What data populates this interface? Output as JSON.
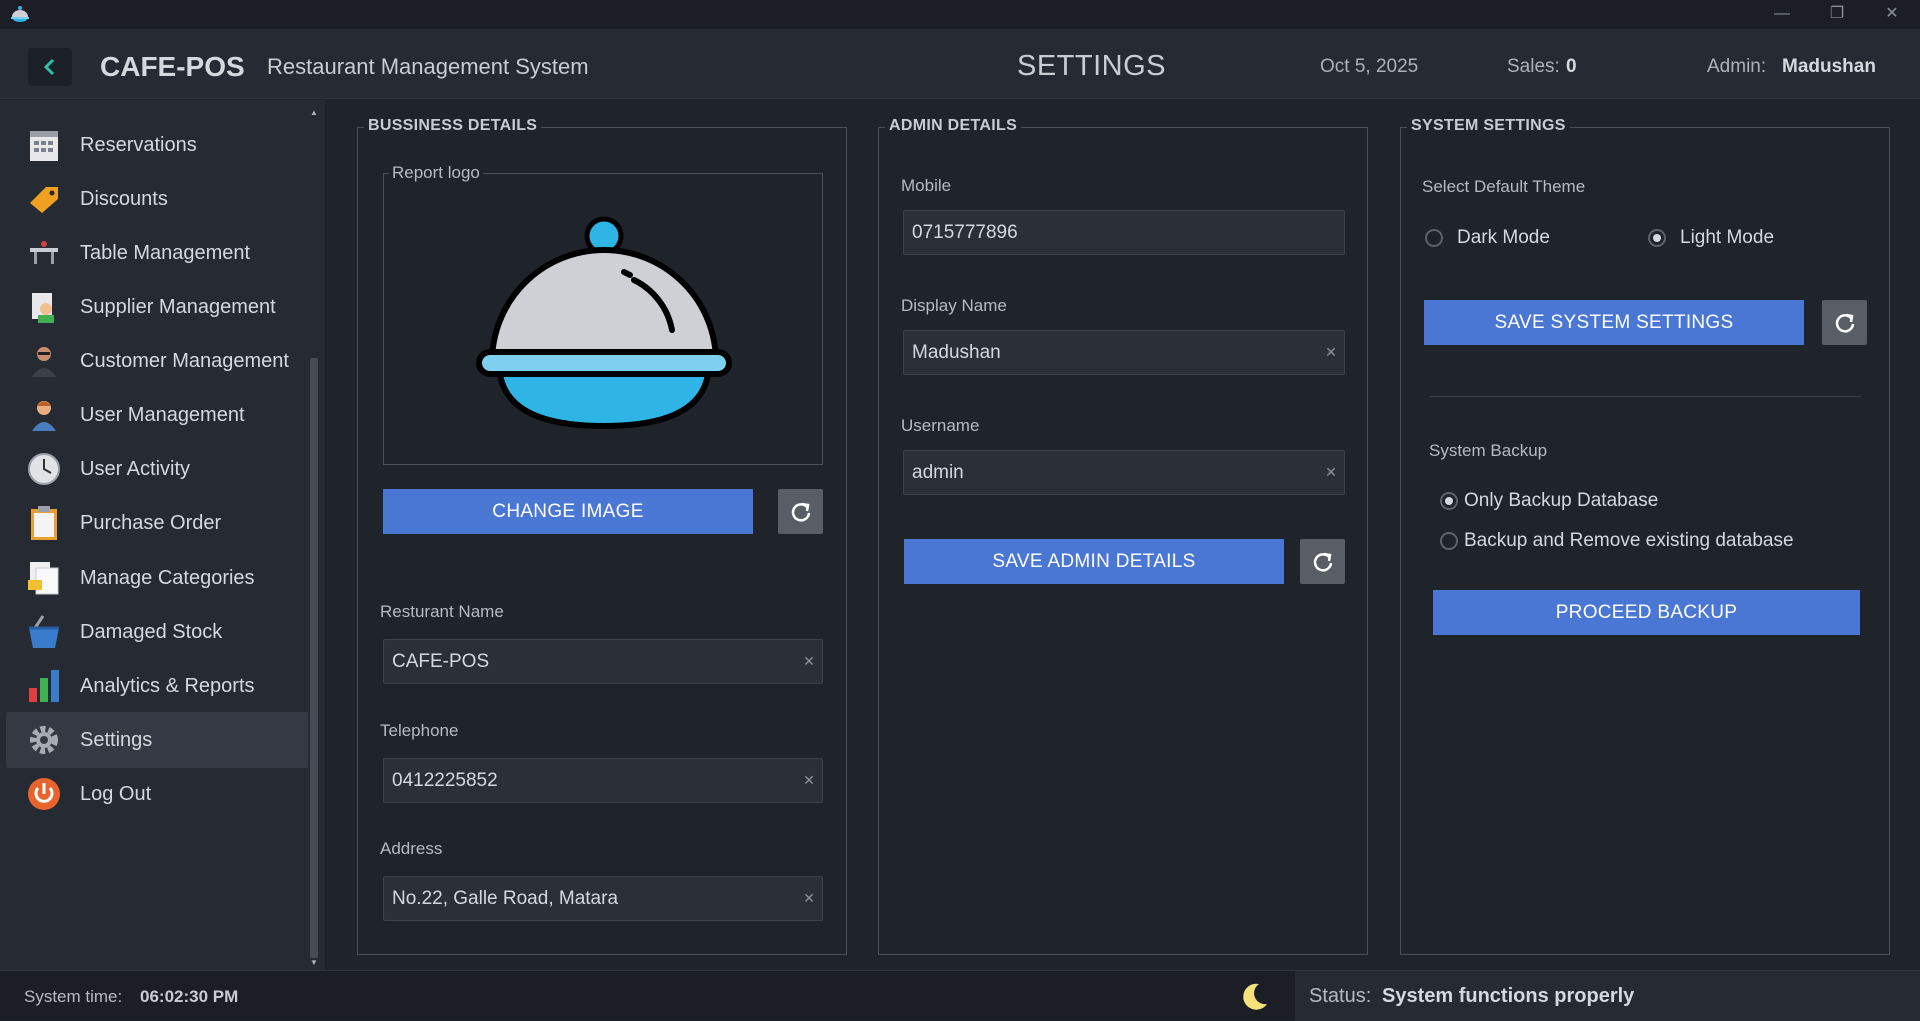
{
  "header": {
    "brand": "CAFE-POS",
    "subtitle": "Restaurant Management System",
    "page_title": "SETTINGS",
    "date": "Oct 5, 2025",
    "sales_label": "Sales:",
    "sales_value": "0",
    "admin_label": "Admin:",
    "admin_value": "Madushan"
  },
  "sidebar": {
    "items": [
      {
        "label": "Reservations",
        "icon": "reservations-icon"
      },
      {
        "label": "Discounts",
        "icon": "discount-tag-icon"
      },
      {
        "label": "Table Management",
        "icon": "table-icon"
      },
      {
        "label": "Supplier Management",
        "icon": "supplier-icon"
      },
      {
        "label": "Customer Management",
        "icon": "customer-icon"
      },
      {
        "label": "User Management",
        "icon": "user-icon"
      },
      {
        "label": "User Activity",
        "icon": "clock-icon"
      },
      {
        "label": "Purchase Order",
        "icon": "clipboard-icon"
      },
      {
        "label": "Manage Categories",
        "icon": "documents-icon"
      },
      {
        "label": "Damaged Stock",
        "icon": "basket-icon"
      },
      {
        "label": "Analytics & Reports",
        "icon": "bar-chart-icon"
      },
      {
        "label": "Settings",
        "icon": "gear-icon",
        "active": true
      },
      {
        "label": "Log Out",
        "icon": "power-icon"
      }
    ]
  },
  "business": {
    "legend": "BUSSINESS DETAILS",
    "logo_legend": "Report logo",
    "change_image_label": "CHANGE IMAGE",
    "restaurant_name_label": "Resturant Name",
    "restaurant_name_value": "CAFE-POS",
    "telephone_label": "Telephone",
    "telephone_value": "0412225852",
    "address_label": "Address",
    "address_value": "No.22, Galle Road, Matara"
  },
  "admin": {
    "legend": "ADMIN DETAILS",
    "mobile_label": "Mobile",
    "mobile_value": "0715777896",
    "display_name_label": "Display Name",
    "display_name_value": "Madushan",
    "username_label": "Username",
    "username_value": "admin",
    "save_label": "SAVE ADMIN DETAILS"
  },
  "system": {
    "legend": "SYSTEM SETTINGS",
    "theme_label": "Select Default Theme",
    "dark_mode_label": "Dark Mode",
    "light_mode_label": "Light Mode",
    "selected_theme": "Light Mode",
    "save_label": "SAVE SYSTEM SETTINGS",
    "backup_label": "System Backup",
    "backup_only_label": "Only Backup Database",
    "backup_remove_label": "Backup and Remove existing database",
    "selected_backup": "Only Backup Database",
    "proceed_label": "PROCEED BACKUP"
  },
  "statusbar": {
    "time_label": "System time:",
    "time_value": "06:02:30 PM",
    "status_label": "Status:",
    "status_value": "System functions properly"
  },
  "colors": {
    "accent": "#4a77d4",
    "background": "#1f232a",
    "panel": "#262a32",
    "logo_blue": "#2fb4e6"
  }
}
